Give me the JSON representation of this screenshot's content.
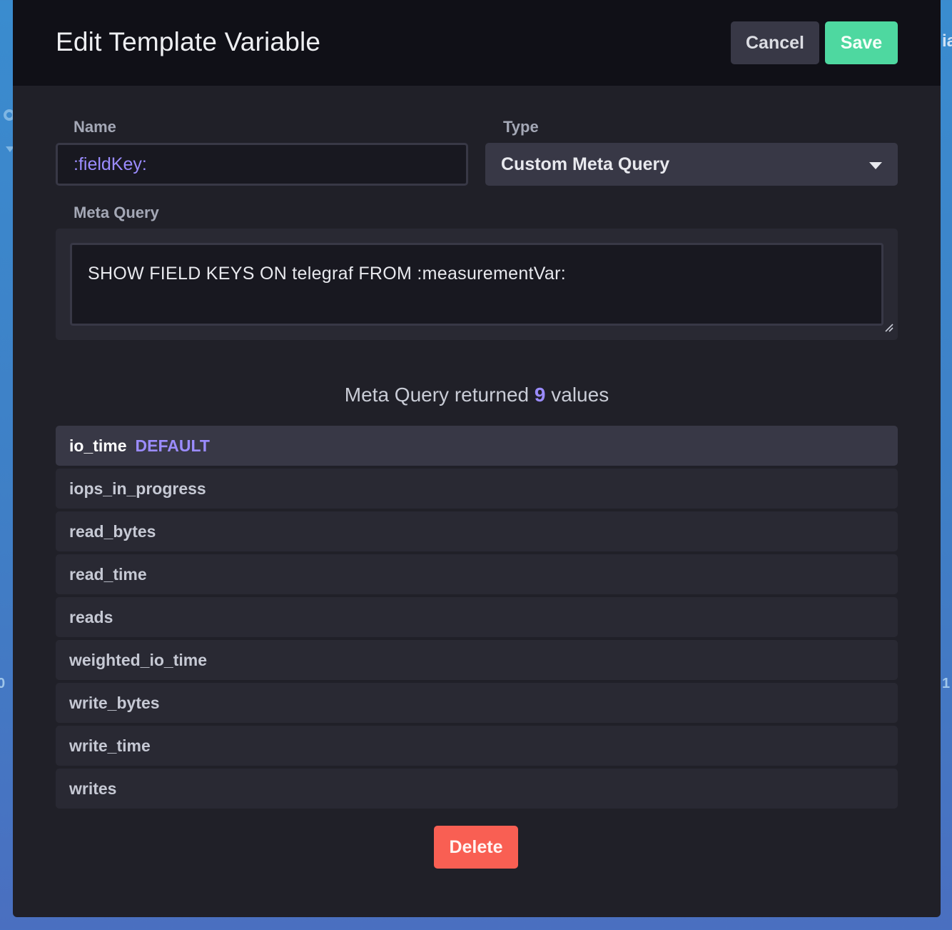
{
  "background": {
    "left_tick": "0",
    "right_tick": "1",
    "right_partial_text": "ia"
  },
  "modal": {
    "title": "Edit Template Variable",
    "cancel_label": "Cancel",
    "save_label": "Save",
    "delete_label": "Delete"
  },
  "form": {
    "name_label": "Name",
    "name_value": ":fieldKey:",
    "type_label": "Type",
    "type_value": "Custom Meta Query",
    "meta_query_label": "Meta Query",
    "meta_query_value": "SHOW FIELD KEYS ON telegraf FROM :measurementVar:"
  },
  "results": {
    "prefix": "Meta Query returned",
    "count": "9",
    "suffix": "values",
    "default_badge": "DEFAULT",
    "values": [
      "io_time",
      "iops_in_progress",
      "read_bytes",
      "read_time",
      "reads",
      "weighted_io_time",
      "write_bytes",
      "write_time",
      "writes"
    ]
  },
  "colors": {
    "accent": "#9b8cff",
    "save": "#4ed8a0",
    "delete": "#f95f53",
    "header_bg": "#101017",
    "modal_bg": "#202028"
  },
  "icons": {
    "select_caret": "chevron-down-icon",
    "resize": "resize-handle-icon",
    "background_gear": "gear-icon"
  }
}
